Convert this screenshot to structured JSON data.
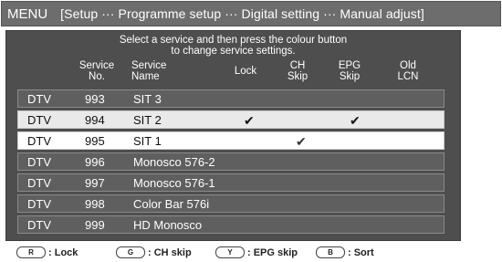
{
  "header": {
    "menu": "MENU",
    "breadcrumb": "[Setup ··· Programme setup ··· Digital setting ··· Manual adjust]"
  },
  "instruction": {
    "line1": "Select a service and then press the colour button",
    "line2": "to change service settings."
  },
  "columns": {
    "service_no": "Service\nNo.",
    "service_name": "Service\nName",
    "lock": "Lock",
    "ch_skip": "CH\nSkip",
    "epg_skip": "EPG\nSkip",
    "old_lcn": "Old\nLCN"
  },
  "rows": [
    {
      "type": "DTV",
      "no": "993",
      "name": "SIT 3",
      "lock": "",
      "ch": "",
      "epg": ""
    },
    {
      "type": "DTV",
      "no": "994",
      "name": "SIT 2",
      "lock": "✔",
      "ch": "",
      "epg": "✔"
    },
    {
      "type": "DTV",
      "no": "995",
      "name": "SIT 1",
      "lock": "",
      "ch": "✔",
      "epg": ""
    },
    {
      "type": "DTV",
      "no": "996",
      "name": "Monosco 576-2",
      "lock": "",
      "ch": "",
      "epg": ""
    },
    {
      "type": "DTV",
      "no": "997",
      "name": "Monosco 576-1",
      "lock": "",
      "ch": "",
      "epg": ""
    },
    {
      "type": "DTV",
      "no": "998",
      "name": "Color Bar 576i",
      "lock": "",
      "ch": "",
      "epg": ""
    },
    {
      "type": "DTV",
      "no": "999",
      "name": "HD Monosco",
      "lock": "",
      "ch": "",
      "epg": ""
    }
  ],
  "footer": {
    "r_key": "R",
    "r_label": ": Lock",
    "g_key": "G",
    "g_label": ": CH skip",
    "y_key": "Y",
    "y_label": ": EPG skip",
    "b_key": "B",
    "b_label": ": Sort"
  }
}
